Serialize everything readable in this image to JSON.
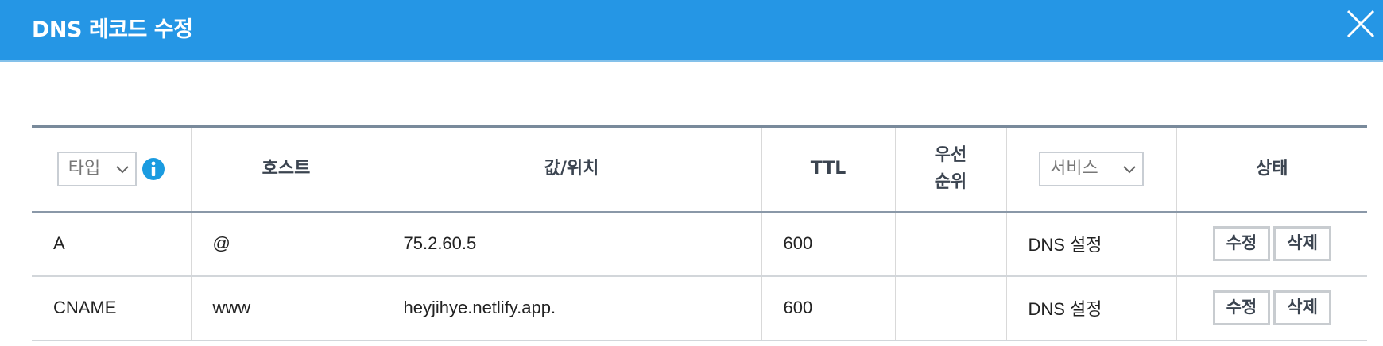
{
  "dialog": {
    "title": "DNS 레코드 수정",
    "close_icon": "close-icon"
  },
  "table": {
    "headers": {
      "type_select": "타입",
      "host": "호스트",
      "value": "값/위치",
      "ttl": "TTL",
      "priority": "우선\n순위",
      "service_select": "서비스",
      "status": "상태"
    },
    "rows": [
      {
        "type": "A",
        "host": "@",
        "value": "75.2.60.5",
        "ttl": "600",
        "priority": "",
        "service": "DNS 설정",
        "edit": "수정",
        "delete": "삭제"
      },
      {
        "type": "CNAME",
        "host": "www",
        "value": "heyjihye.netlify.app.",
        "ttl": "600",
        "priority": "",
        "service": "DNS 설정",
        "edit": "수정",
        "delete": "삭제"
      }
    ]
  },
  "colors": {
    "header_bg": "#2596e5",
    "info_icon": "#1a9be0"
  }
}
